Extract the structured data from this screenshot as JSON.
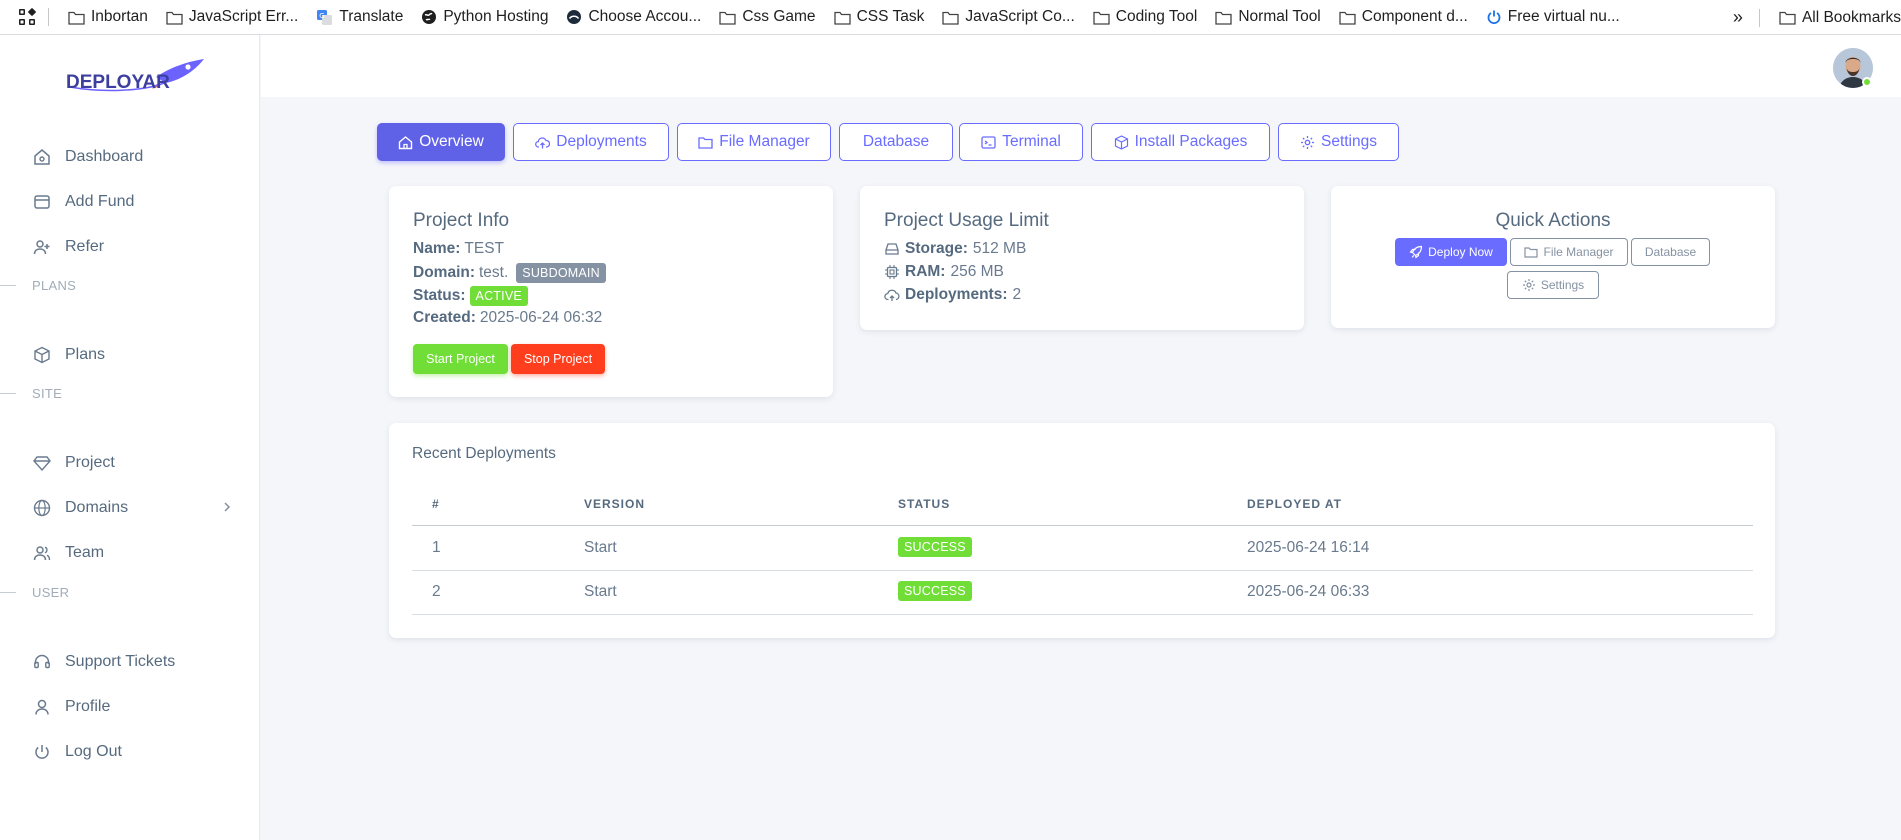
{
  "bookmarks": {
    "items": [
      {
        "label": "Inbortan",
        "icon": "folder-icon"
      },
      {
        "label": "JavaScript Err...",
        "icon": "folder-icon"
      },
      {
        "label": "Translate",
        "icon": "translate-icon"
      },
      {
        "label": "Python Hosting",
        "icon": "globe-icon"
      },
      {
        "label": "Choose Accou...",
        "icon": "site-icon"
      },
      {
        "label": "Css Game",
        "icon": "folder-icon"
      },
      {
        "label": "CSS Task",
        "icon": "folder-icon"
      },
      {
        "label": "JavaScript Co...",
        "icon": "folder-icon"
      },
      {
        "label": "Coding Tool",
        "icon": "folder-icon"
      },
      {
        "label": "Normal Tool",
        "icon": "folder-icon"
      },
      {
        "label": "Component d...",
        "icon": "folder-icon"
      },
      {
        "label": "Free virtual nu...",
        "icon": "power-icon"
      }
    ],
    "overflow": "»",
    "all_bookmarks": "All Bookmarks"
  },
  "brand": {
    "logo_text": "DEPLOYAR",
    "accent": "#696cff"
  },
  "sidebar": {
    "dashboard": "Dashboard",
    "add_fund": "Add Fund",
    "refer": "Refer",
    "section_plans": "PLANS",
    "plans": "Plans",
    "section_site": "SITE",
    "project": "Project",
    "domains": "Domains",
    "team": "Team",
    "section_user": "USER",
    "support_tickets": "Support Tickets",
    "profile": "Profile",
    "log_out": "Log Out"
  },
  "tabs": {
    "overview": "Overview",
    "deployments": "Deployments",
    "file_manager": "File Manager",
    "database": "Database",
    "terminal": "Terminal",
    "install_packages": "Install Packages",
    "settings": "Settings"
  },
  "project_info": {
    "title": "Project Info",
    "name_label": "Name:",
    "name_value": "TEST",
    "domain_label": "Domain:",
    "domain_value": "test.",
    "domain_badge": "SUBDOMAIN",
    "status_label": "Status:",
    "status_badge": "ACTIVE",
    "created_label": "Created:",
    "created_value": "2025-06-24 06:32",
    "start_button": "Start Project",
    "stop_button": "Stop Project"
  },
  "usage": {
    "title": "Project Usage Limit",
    "storage_label": "Storage:",
    "storage_value": "512 MB",
    "ram_label": "RAM:",
    "ram_value": "256 MB",
    "deployments_label": "Deployments:",
    "deployments_value": "2"
  },
  "quick_actions": {
    "title": "Quick Actions",
    "deploy_now": "Deploy Now",
    "file_manager": "File Manager",
    "database": "Database",
    "settings": "Settings"
  },
  "recent_deployments": {
    "title": "Recent Deployments",
    "columns": [
      "#",
      "VERSION",
      "STATUS",
      "DEPLOYED AT"
    ],
    "rows": [
      {
        "num": "1",
        "version": "Start",
        "status": "SUCCESS",
        "deployed_at": "2025-06-24 16:14"
      },
      {
        "num": "2",
        "version": "Start",
        "status": "SUCCESS",
        "deployed_at": "2025-06-24 06:33"
      }
    ]
  },
  "colors": {
    "primary": "#696cff",
    "success": "#71dd37",
    "danger": "#ff3e1d",
    "secondary": "#8592a3"
  }
}
